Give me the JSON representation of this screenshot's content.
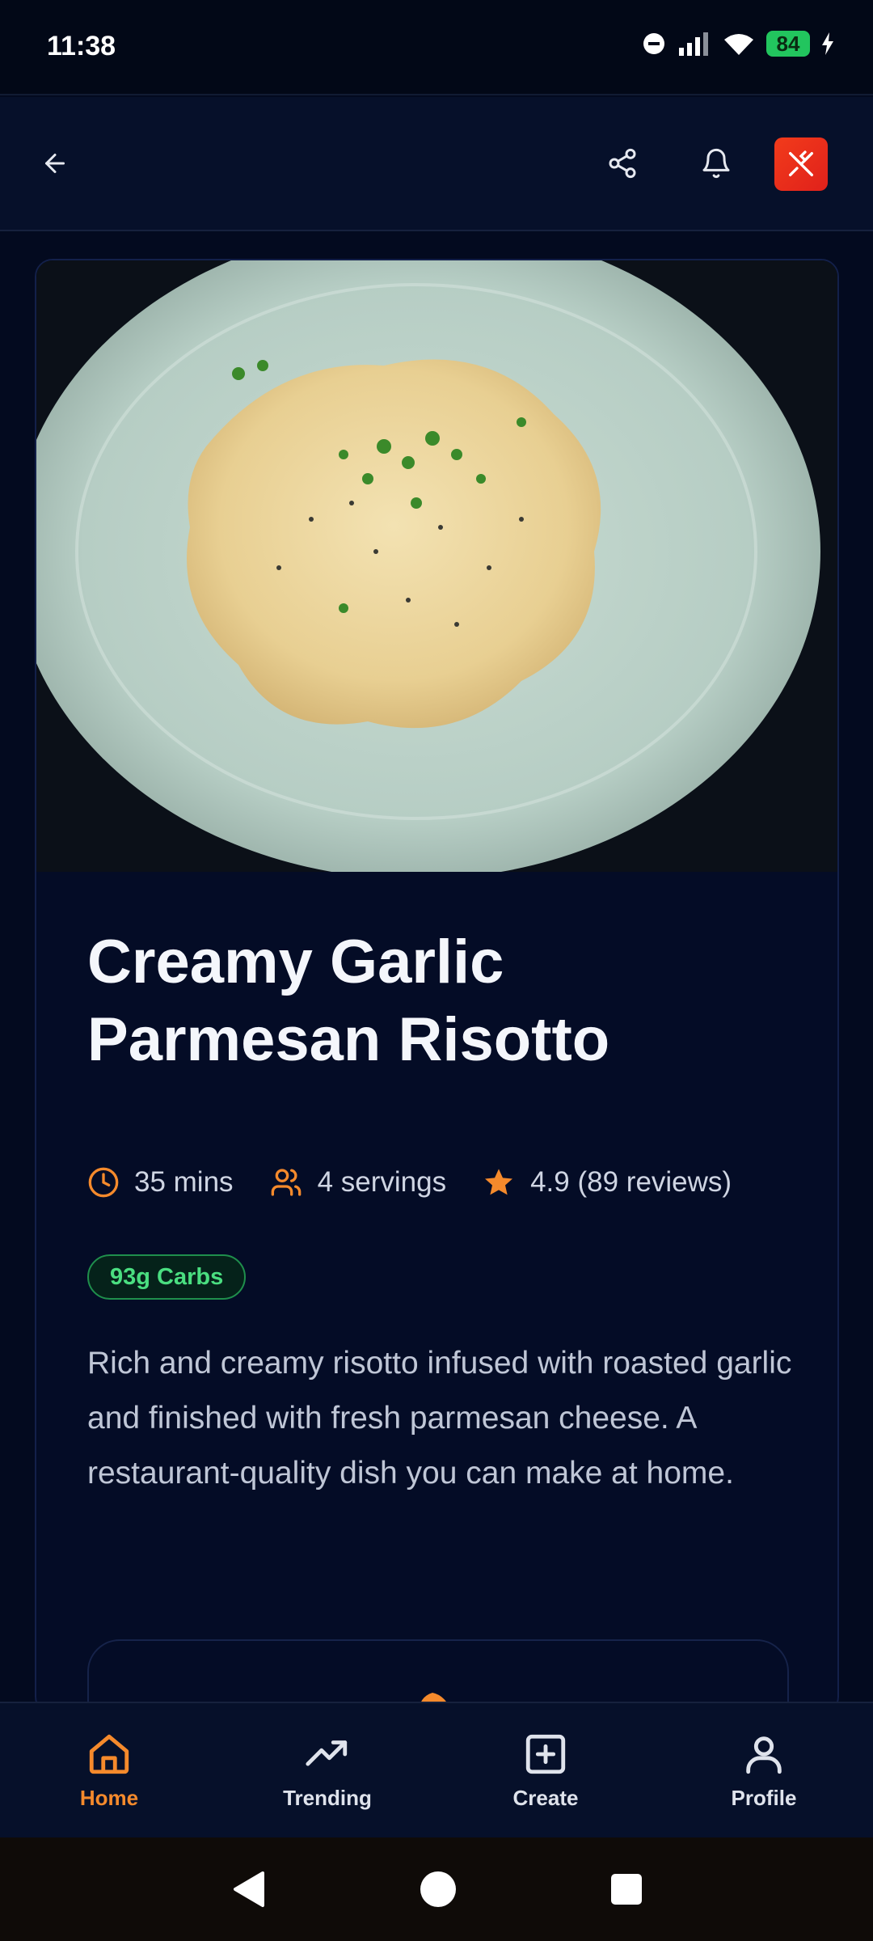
{
  "status_bar": {
    "time": "11:38",
    "battery": "84"
  },
  "header": {
    "back_label": "Back",
    "share_label": "Share",
    "notifications_label": "Notifications"
  },
  "recipe": {
    "title": "Creamy Garlic Parmesan Risotto",
    "time": "35 mins",
    "servings": "4 servings",
    "rating": "4.9 (89 reviews)",
    "carbs_badge": "93g Carbs",
    "description": "Rich and creamy risotto infused with roasted garlic and finished with fresh parmesan cheese. A restaurant-quality dish you can make at home."
  },
  "bottom_nav": [
    {
      "label": "Home",
      "active": true
    },
    {
      "label": "Trending",
      "active": false
    },
    {
      "label": "Create",
      "active": false
    },
    {
      "label": "Profile",
      "active": false
    }
  ],
  "colors": {
    "accent": "#f58a2c",
    "logo_red": "#e0211b",
    "badge_green": "#4ade80",
    "background": "#030a1f"
  },
  "icons": {
    "back": "arrow-left-icon",
    "share": "share-icon",
    "bell": "bell-icon",
    "logo": "utensils-crossed-icon",
    "clock": "clock-icon",
    "users": "users-icon",
    "star": "star-icon"
  }
}
